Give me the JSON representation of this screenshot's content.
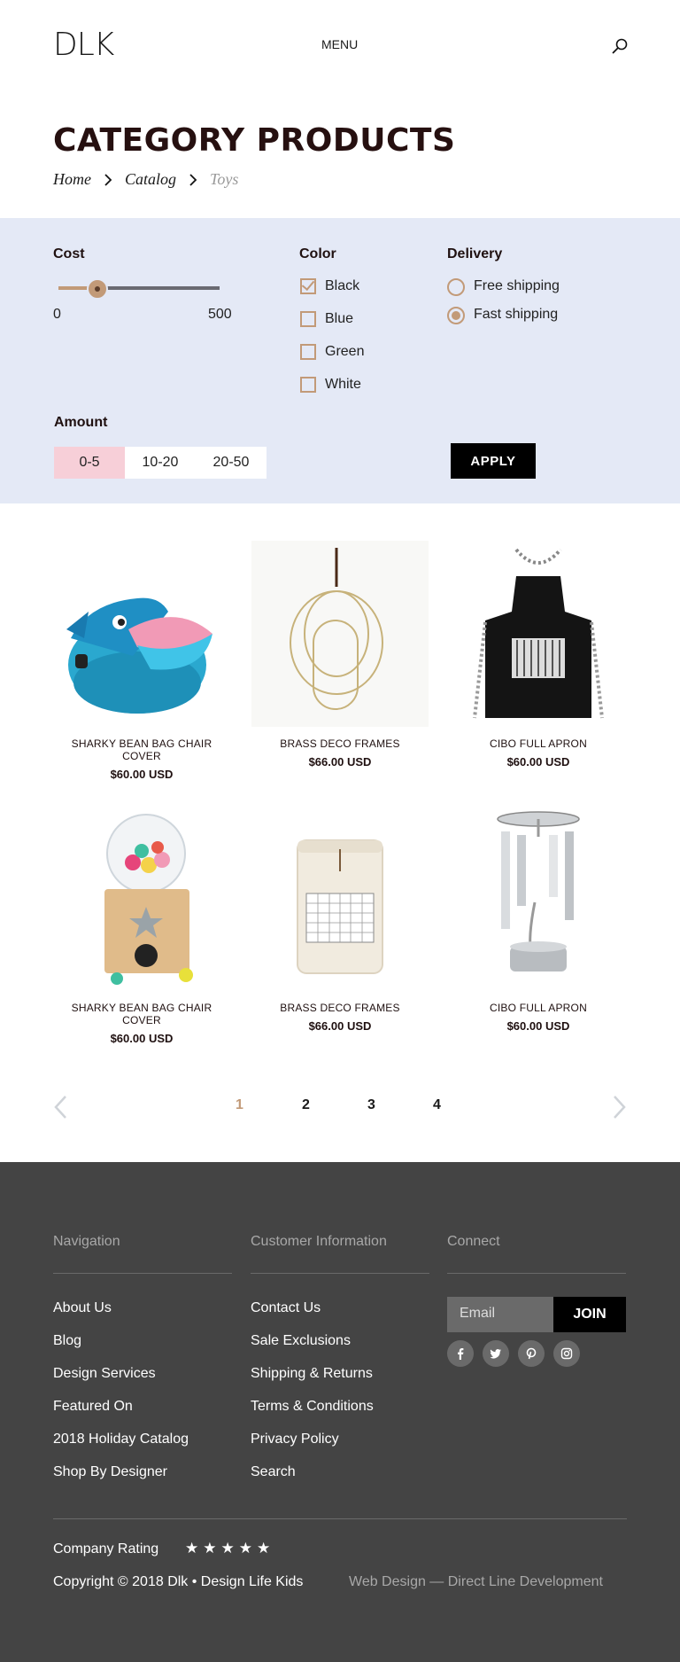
{
  "header": {
    "logo": "DLK",
    "menu_label": "MENU",
    "search_icon": "search-icon"
  },
  "page": {
    "title": "CATEGORY PRODUCTS",
    "breadcrumb": [
      "Home",
      "Catalog",
      "Toys"
    ]
  },
  "filters": {
    "cost": {
      "label": "Cost",
      "min_label": "0",
      "max_label": "500",
      "value": 0.24
    },
    "color": {
      "label": "Color",
      "options": [
        {
          "label": "Black",
          "checked": true
        },
        {
          "label": "Blue",
          "checked": false
        },
        {
          "label": "Green",
          "checked": false
        },
        {
          "label": "White",
          "checked": false
        }
      ]
    },
    "delivery": {
      "label": "Delivery",
      "options": [
        {
          "label": "Free shipping",
          "selected": false
        },
        {
          "label": "Fast shipping",
          "selected": true
        }
      ]
    },
    "amount": {
      "label": "Amount",
      "options": [
        "0-5",
        "10-20",
        "20-50"
      ],
      "selected": "0-5"
    },
    "apply_label": "APPLY"
  },
  "products": [
    {
      "name": "SHARKY BEAN BAG CHAIR COVER",
      "price": "$60.00 USD",
      "image": "shark-bean-bag"
    },
    {
      "name": "BRASS DECO FRAMES",
      "price": "$66.00 USD",
      "image": "brass-frames"
    },
    {
      "name": "CIBO FULL APRON",
      "price": "$60.00 USD",
      "image": "black-apron"
    },
    {
      "name": "SHARKY BEAN BAG CHAIR COVER",
      "price": "$60.00 USD",
      "image": "gumball-machine"
    },
    {
      "name": "BRASS DECO FRAMES",
      "price": "$66.00 USD",
      "image": "calendar-candle"
    },
    {
      "name": "CIBO FULL APRON",
      "price": "$60.00 USD",
      "image": "chime-candle-holder"
    }
  ],
  "pagination": {
    "pages": [
      "1",
      "2",
      "3",
      "4"
    ],
    "active": "1",
    "prev_icon": "chevron-left-icon",
    "next_icon": "chevron-right-icon"
  },
  "footer": {
    "navigation": {
      "title": "Navigation",
      "links": [
        "About Us",
        "Blog",
        "Design Services",
        "Featured On",
        "2018 Holiday Catalog",
        "Shop By Designer"
      ]
    },
    "customer": {
      "title": "Customer Information",
      "links": [
        "Contact Us",
        "Sale Exclusions",
        "Shipping & Returns",
        "Terms & Conditions",
        "Privacy Policy",
        "Search"
      ]
    },
    "connect": {
      "title": "Connect",
      "email_placeholder": "Email",
      "join_label": "JOIN",
      "social": [
        "facebook-icon",
        "twitter-icon",
        "pinterest-icon",
        "instagram-icon"
      ]
    },
    "rating_label": "Company Rating",
    "rating_stars": "★★★★★",
    "copyright": "Copyright © 2018 Dlk • Design Life Kids",
    "credit": "Web Design — Direct Line Development"
  },
  "colors": {
    "accent": "#c29a78",
    "filter_bg": "#e4e9f6",
    "selected_amount": "#f7cfd8",
    "footer_bg": "#444444"
  }
}
